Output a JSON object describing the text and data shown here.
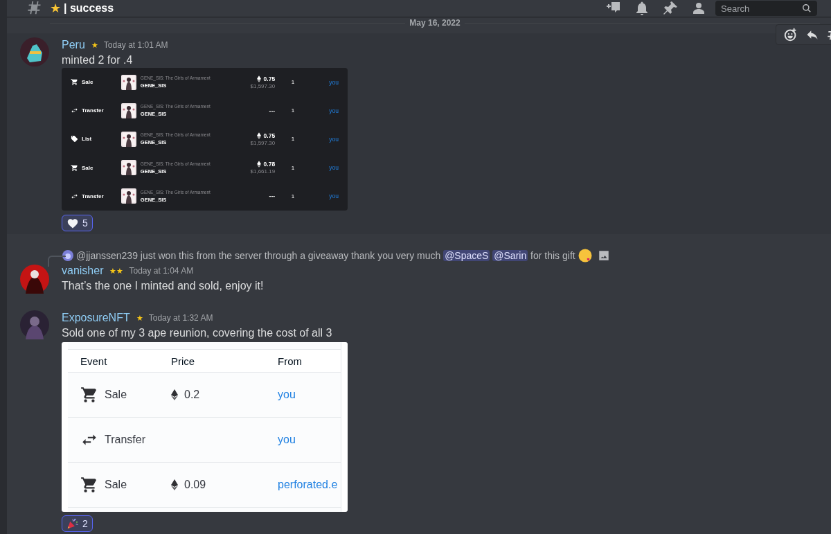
{
  "channel_header": {
    "badge": "★",
    "name": "| success",
    "search": {
      "placeholder": "Search"
    }
  },
  "date_divider": "May 16, 2022",
  "messages": [
    {
      "author": "Peru",
      "badge": "★",
      "timestamp": "Today at 1:01 AM",
      "text": "minted 2 for .4",
      "hovered": true,
      "embed": {
        "kind": "activity_dark",
        "rows": [
          {
            "kind": "sale",
            "event": "Sale",
            "collection": "GENE_SIS: The Girls of Armament",
            "item": "GENE_SIS",
            "eth": true,
            "price": "0.75",
            "usd": "$1,597.30",
            "quantity": "1",
            "from": "you"
          },
          {
            "kind": "transfer",
            "event": "Transfer",
            "collection": "GENE_SIS: The Girls of Armament",
            "item": "GENE_SIS",
            "eth": false,
            "price": "---",
            "quantity": "1",
            "from": "you"
          },
          {
            "kind": "list",
            "event": "List",
            "collection": "GENE_SIS: The Girls of Armament",
            "item": "GENE_SIS",
            "eth": true,
            "price": "0.75",
            "usd": "$1,597.30",
            "quantity": "1",
            "from": "you"
          },
          {
            "kind": "sale",
            "event": "Sale",
            "collection": "GENE_SIS: The Girls of Armament",
            "item": "GENE_SIS",
            "eth": true,
            "price": "0.78",
            "usd": "$1,661.19",
            "quantity": "1",
            "from": "you"
          },
          {
            "kind": "transfer",
            "event": "Transfer",
            "collection": "GENE_SIS: The Girls of Armament",
            "item": "GENE_SIS",
            "eth": false,
            "price": "---",
            "quantity": "1",
            "from": "you"
          }
        ]
      },
      "reactions": [
        {
          "kind": "heart",
          "count": "5",
          "selected": true
        }
      ]
    },
    {
      "author": "vanisher",
      "badge": "★★",
      "timestamp": "Today at 1:04 AM",
      "text": "That’s the one I minted and sold, enjoy it!",
      "hovered": false,
      "reply": {
        "author": "@jjanssen239",
        "parts": [
          {
            "kind": "text",
            "text": "just won this from the server through a giveaway thank you very much"
          },
          {
            "kind": "mention",
            "text": "@SpaceS"
          },
          {
            "kind": "mention",
            "text": "@Sarin"
          },
          {
            "kind": "text",
            "text": "for this gift"
          }
        ]
      }
    },
    {
      "author": "ExposureNFT",
      "badge": "★",
      "timestamp": "Today at 1:32 AM",
      "text": "Sold one of my 3 ape reunion, covering the cost of all 3",
      "hovered": false,
      "embed": {
        "kind": "activity_light",
        "columns": [
          "Event",
          "Price",
          "From"
        ],
        "rows": [
          {
            "kind": "sale",
            "event": "Sale",
            "price": "0.2",
            "from": "you"
          },
          {
            "kind": "transfer",
            "event": "Transfer",
            "from": "you"
          },
          {
            "kind": "sale",
            "event": "Sale",
            "price": "0.09",
            "from": "perforated.e"
          }
        ]
      },
      "reactions": [
        {
          "kind": "party",
          "count": "2",
          "selected": true
        }
      ]
    }
  ]
}
